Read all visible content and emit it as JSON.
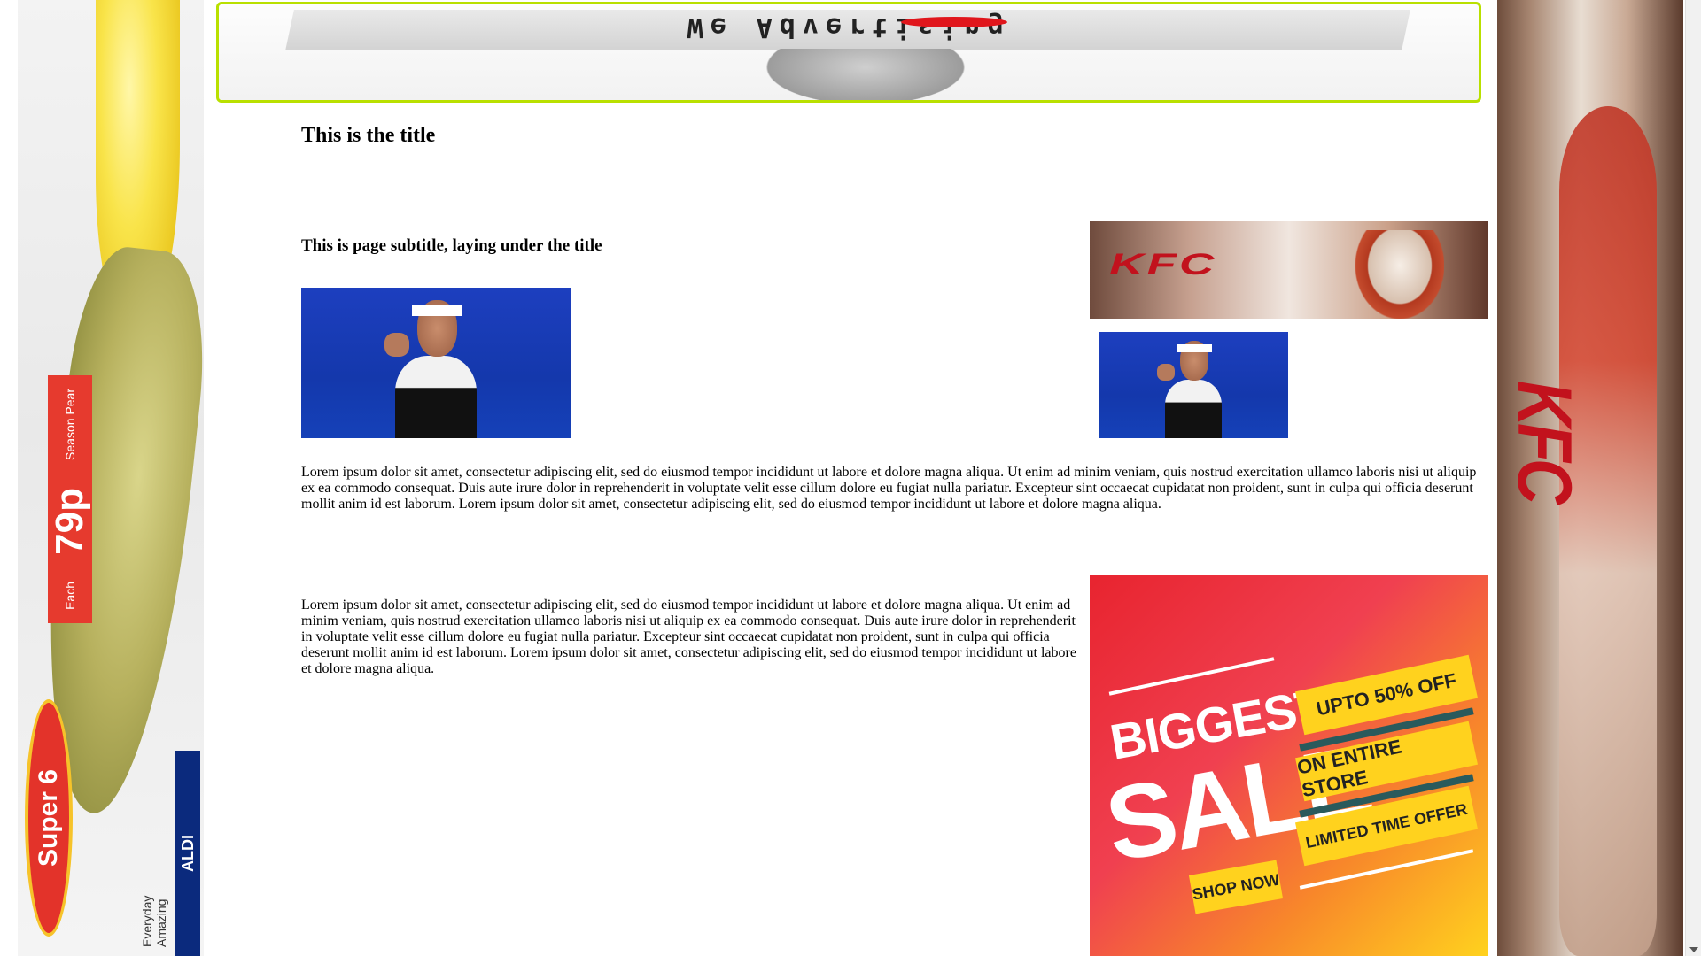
{
  "banner": {
    "text": "We Advertising"
  },
  "page": {
    "title": "This is the title",
    "subtitle": "This is page subtitle, laying under the title",
    "paragraph_1": "Lorem ipsum dolor sit amet, consectetur adipiscing elit, sed do eiusmod tempor incididunt ut labore et dolore magna aliqua. Ut enim ad minim veniam, quis nostrud exercitation ullamco laboris nisi ut aliquip ex ea commodo consequat. Duis aute irure dolor in reprehenderit in voluptate velit esse cillum dolore eu fugiat nulla pariatur. Excepteur sint occaecat cupidatat non proident, sunt in culpa qui officia deserunt mollit anim id est laborum. Lorem ipsum dolor sit amet, consectetur adipiscing elit, sed do eiusmod tempor incididunt ut labore et dolore magna aliqua.",
    "paragraph_2": "Lorem ipsum dolor sit amet, consectetur adipiscing elit, sed do eiusmod tempor incididunt ut labore et dolore magna aliqua. Ut enim ad minim veniam, quis nostrud exercitation ullamco laboris nisi ut aliquip ex ea commodo consequat. Duis aute irure dolor in reprehenderit in voluptate velit esse cillum dolore eu fugiat nulla pariatur. Excepteur sint occaecat cupidatat non proident, sunt in culpa qui officia deserunt mollit anim id est laborum. Lorem ipsum dolor sit amet, consectetur adipiscing elit, sed do eiusmod tempor incididunt ut labore et dolore magna aliqua."
  },
  "left_ad": {
    "price_label": "Season Pear",
    "price": "79p",
    "price_unit": "Each",
    "promo": "Super 6",
    "tagline": "Everyday Amazing",
    "brand": "ALDI"
  },
  "right_ad": {
    "brand": "KFC"
  },
  "kfc_banner": {
    "brand": "KFC"
  },
  "sale_banner": {
    "line_1": "BIGGEST",
    "line_2": "SALE",
    "offer_1": "UPTO 50% OFF",
    "offer_2": "ON ENTIRE STORE",
    "offer_3": "LIMITED TIME OFFER",
    "cta": "SHOP NOW"
  },
  "colors": {
    "banner_border": "#b9e000",
    "kfc_red": "#c2121d",
    "sale_red": "#e8242f",
    "sale_yellow": "#ffd21e",
    "aldi_blue": "#0b2a7d"
  }
}
